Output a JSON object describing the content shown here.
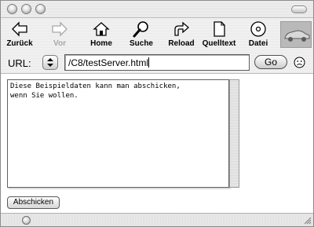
{
  "toolbar": {
    "back_label": "Zurück",
    "forward_label": "Vor",
    "home_label": "Home",
    "search_label": "Suche",
    "reload_label": "Reload",
    "source_label": "Quelltext",
    "file_label": "Datei"
  },
  "address": {
    "label": "URL:",
    "value": "/C8/testServer.html",
    "go_label": "Go"
  },
  "form": {
    "textarea_text": "Diese Beispieldaten kann man abschicken,\nwenn Sie wollen.",
    "submit_label": "Abschicken"
  },
  "icons": {
    "back": "arrow-left-icon",
    "forward": "arrow-right-icon",
    "home": "house-icon",
    "search": "magnifier-icon",
    "reload": "reload-arrow-icon",
    "source": "document-icon",
    "file": "disc-icon",
    "status": "smiley-icon"
  }
}
